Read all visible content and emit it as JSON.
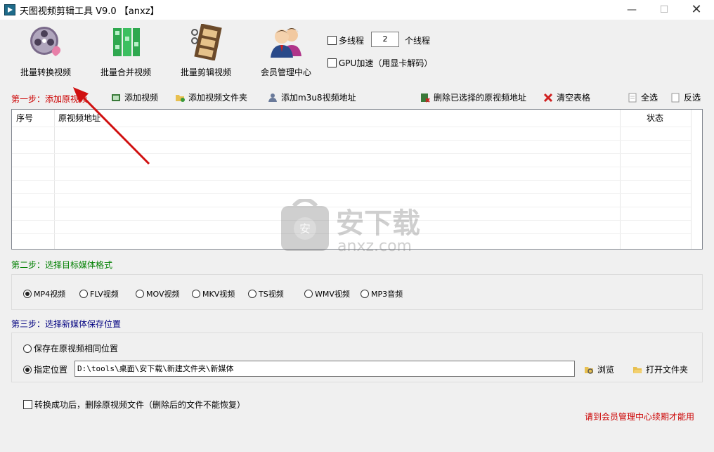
{
  "window": {
    "title": "天图视频剪辑工具 V9.0 【anxz】",
    "min": "—",
    "max": "☐",
    "close": "✕"
  },
  "toolbar": [
    {
      "label": "批量转换视频",
      "icon": "film-reel-icon"
    },
    {
      "label": "批量合并视频",
      "icon": "merge-blocks-icon"
    },
    {
      "label": "批量剪辑视频",
      "icon": "film-strip-scissors-icon"
    },
    {
      "label": "会员管理中心",
      "icon": "users-icon"
    }
  ],
  "options": {
    "multithread_label": "多线程",
    "threads_value": "2",
    "threads_unit": "个线程",
    "gpu_label": "GPU加速（用显卡解码）"
  },
  "step1": {
    "label": "第一步：添加原视频",
    "actions": {
      "add_video": "添加视频",
      "add_folder": "添加视频文件夹",
      "add_m3u8": "添加m3u8视频地址",
      "delete_selected": "删除已选择的原视频地址",
      "clear": "清空表格",
      "select_all": "全选",
      "invert": "反选"
    },
    "columns": [
      "序号",
      "原视频地址",
      "状态"
    ]
  },
  "step2": {
    "label": "第二步：选择目标媒体格式",
    "formats": [
      "MP4视频",
      "FLV视频",
      "MOV视频",
      "MKV视频",
      "TS视频",
      "WMV视频",
      "MP3音频"
    ],
    "selected": "MP4视频"
  },
  "step3": {
    "label": "第三步：选择新媒体保存位置",
    "same_location": "保存在原视频相同位置",
    "custom_location": "指定位置",
    "path": "D:\\tools\\桌面\\安下载\\新建文件夹\\新媒体",
    "browse": "浏览",
    "open_folder": "打开文件夹"
  },
  "footer": {
    "delete_after": "转换成功后，删除原视频文件（删除后的文件不能恢复）",
    "notice": "请到会员管理中心续期才能用"
  },
  "watermark": {
    "text": "安下载",
    "sub": "anxz.com"
  },
  "colors": {
    "step1": "#cc0000",
    "step2": "#008000",
    "step3": "#000080",
    "notice": "#cc0000",
    "arrow": "#d01010"
  }
}
